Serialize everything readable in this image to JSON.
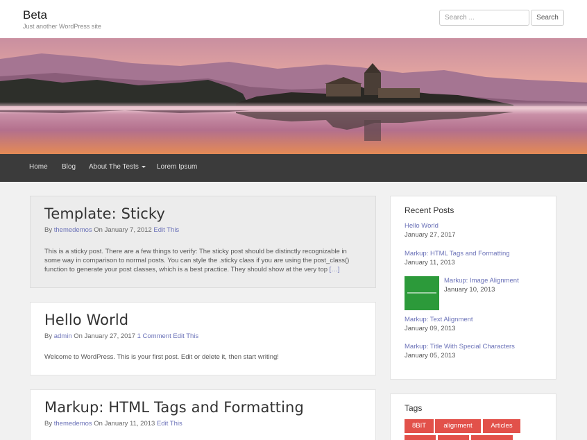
{
  "site": {
    "title": "Beta",
    "tagline": "Just another WordPress site"
  },
  "search": {
    "placeholder": "Search ...",
    "value": "",
    "button_label": "Search"
  },
  "nav": {
    "items": [
      {
        "label": "Home"
      },
      {
        "label": "Blog"
      },
      {
        "label": "About The Tests",
        "has_dropdown": true
      },
      {
        "label": "Lorem Ipsum"
      }
    ]
  },
  "posts": [
    {
      "title": "Template: Sticky",
      "meta_by": "By",
      "author": "themedemos",
      "meta_on": "On January 7, 2012",
      "edit": "Edit This",
      "excerpt_line1": "This is a sticky post. There are a few things to verify: The sticky post should be distinctly recognizable in",
      "excerpt_line2": "some way in comparison to normal posts. You can style the .sticky class if you are using the post_class()",
      "excerpt_line3": "function to generate your post classes, which is a best practice. They should show at the very top",
      "more": "[…]"
    },
    {
      "title": "Hello World",
      "meta_by": "By",
      "author": "admin",
      "meta_on": "On January 27, 2017",
      "comments": "1 Comment",
      "edit": "Edit This",
      "excerpt_line1": "Welcome to WordPress. This is your first post. Edit or delete it, then start writing!"
    },
    {
      "title": "Markup: HTML Tags and Formatting",
      "meta_by": "By",
      "author": "themedemos",
      "meta_on": "On January 11, 2013",
      "edit": "Edit This"
    }
  ],
  "recent_posts": {
    "title": "Recent Posts",
    "items": [
      {
        "title": "Hello World",
        "date": "January 27, 2017"
      },
      {
        "title": "Markup: HTML Tags and Formatting",
        "date": "January 11, 2013"
      },
      {
        "title": "Markup: Image Alignment",
        "date": "January 10, 2013"
      },
      {
        "title": "Markup: Text Alignment",
        "date": "January 09, 2013"
      },
      {
        "title": "Markup: Title With Special Characters",
        "date": "January 05, 2013"
      }
    ]
  },
  "tags": {
    "title": "Tags",
    "items": [
      {
        "label": "8BIT"
      },
      {
        "label": "alignment"
      },
      {
        "label": "Articles"
      }
    ]
  },
  "colors": {
    "accent": "#6b72b8",
    "tag_bg": "#e2514a",
    "nav_bg": "#3b3b3b",
    "thumb_green": "#2c9a3a"
  }
}
